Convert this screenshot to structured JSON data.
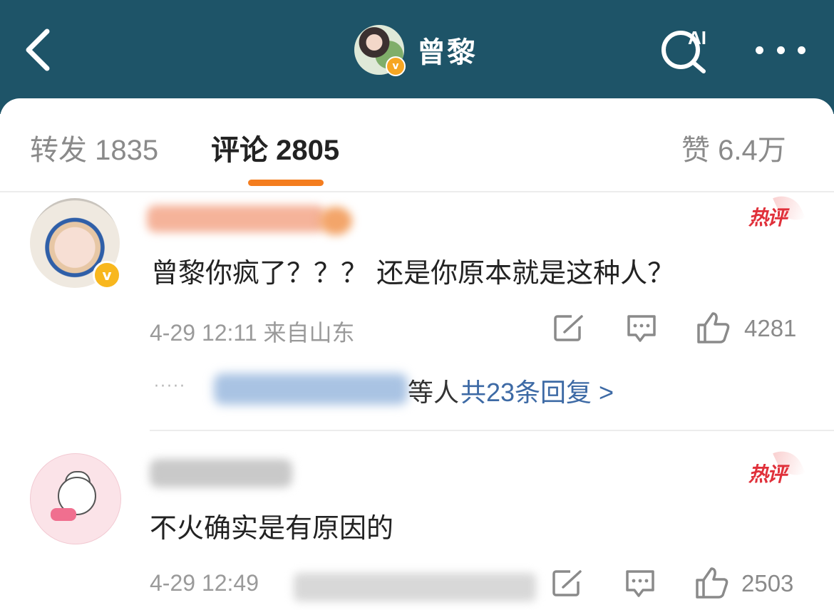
{
  "header": {
    "title": "曾黎",
    "ai_label": "AI",
    "verified_badge": "v"
  },
  "tabs": [
    {
      "label": "转发 1835"
    },
    {
      "label": "评论 2805"
    },
    {
      "label": "赞 6.4万"
    }
  ],
  "comments": [
    {
      "badge": "热评",
      "verified_badge": "v",
      "text": "曾黎你疯了？？？ 还是你原本就是这种人？",
      "time": "4-29 12:11 来自山东",
      "likes": "4281",
      "reply_dots": "·····",
      "reply_suffix": "等人",
      "reply_link": "共23条回复 >"
    },
    {
      "badge": "热评",
      "text": "不火确实是有原因的",
      "time": "4-29 12:49",
      "likes": "2503"
    }
  ],
  "colors": {
    "header_bg": "#1e5468",
    "tab_indicator": "#f47d1f",
    "hot_badge": "#e0303a",
    "link": "#3d6aa5",
    "verified": "#f8b71e"
  }
}
